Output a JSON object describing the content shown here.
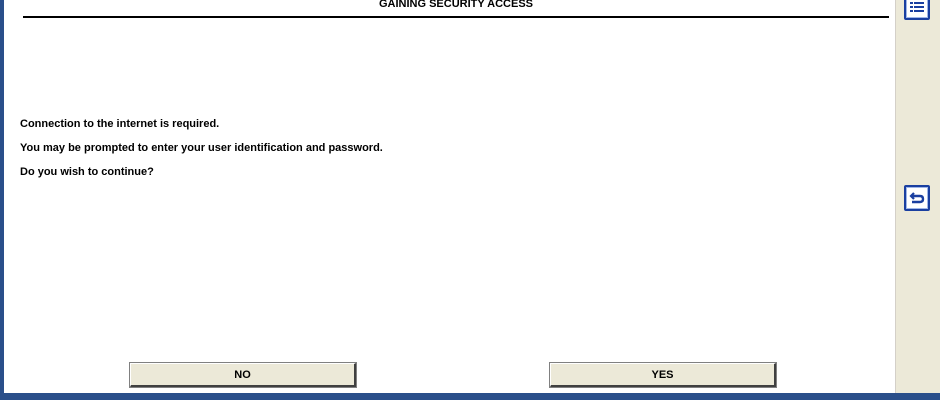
{
  "dialog": {
    "title": "GAINING SECURITY ACCESS",
    "messages": [
      "Connection to the internet is required.",
      "You may be prompted to enter your user identification and password.",
      "Do you wish to continue?"
    ]
  },
  "buttons": {
    "no_label": "NO",
    "yes_label": "YES"
  },
  "sidebar": {
    "icons": [
      "list-icon",
      "back-arrow-icon"
    ]
  },
  "colors": {
    "accent_blue": "#1a3fa0",
    "frame_blue": "#2a4f8a",
    "chrome": "#ece9d8"
  }
}
